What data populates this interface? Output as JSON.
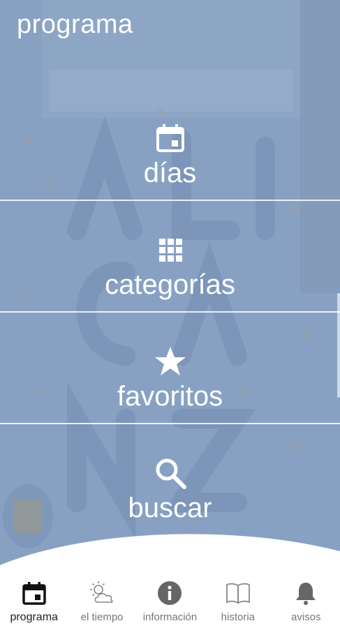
{
  "header": {
    "title": "programa"
  },
  "menu": {
    "items": [
      {
        "label": "días",
        "icon": "calendar-icon"
      },
      {
        "label": "categorías",
        "icon": "grid-icon"
      },
      {
        "label": "favoritos",
        "icon": "star-icon"
      },
      {
        "label": "buscar",
        "icon": "search-icon"
      }
    ]
  },
  "tabbar": {
    "tabs": [
      {
        "label": "programa",
        "icon": "calendar-icon",
        "active": true
      },
      {
        "label": "el tiempo",
        "icon": "weather-icon"
      },
      {
        "label": "información",
        "icon": "info-icon"
      },
      {
        "label": "historia",
        "icon": "book-icon"
      },
      {
        "label": "avisos",
        "icon": "bell-icon"
      }
    ]
  },
  "colors": {
    "overlay": "#8fa8c6",
    "text_on_overlay": "#ffffff",
    "tab_active": "#222222",
    "tab_inactive": "#777777"
  }
}
